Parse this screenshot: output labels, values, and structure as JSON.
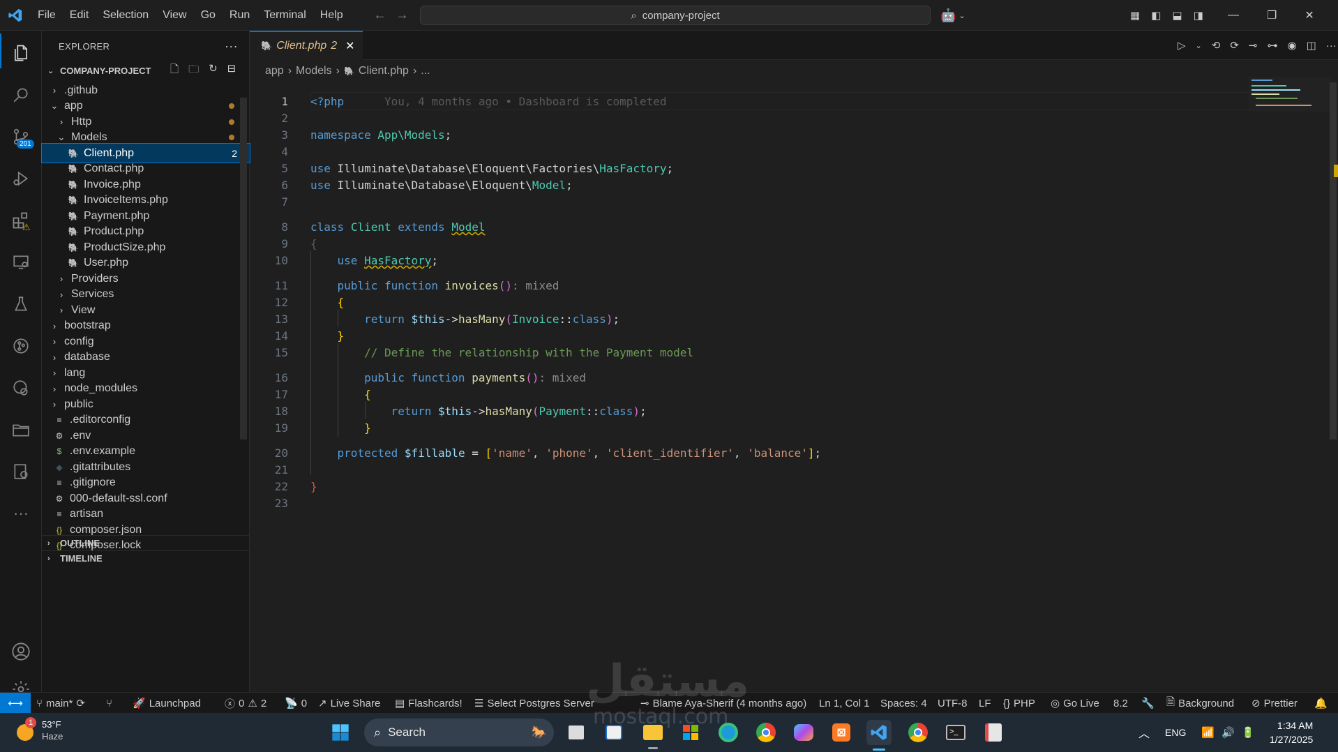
{
  "titlebar": {
    "menu": [
      "File",
      "Edit",
      "Selection",
      "View",
      "Go",
      "Run",
      "Terminal",
      "Help"
    ],
    "search_text": "company-project"
  },
  "explorer": {
    "header": "EXPLORER",
    "project": "COMPANY-PROJECT",
    "items": [
      {
        "label": ".github",
        "type": "folder",
        "open": false,
        "indent": 1
      },
      {
        "label": "app",
        "type": "folder",
        "open": true,
        "indent": 1,
        "modified": true
      },
      {
        "label": "Http",
        "type": "folder",
        "open": false,
        "indent": 2,
        "modified": true
      },
      {
        "label": "Models",
        "type": "folder",
        "open": true,
        "indent": 2,
        "modified": true
      },
      {
        "label": "Client.php",
        "type": "php",
        "indent": 3,
        "badge": "2",
        "selected": true
      },
      {
        "label": "Contact.php",
        "type": "php",
        "indent": 3
      },
      {
        "label": "Invoice.php",
        "type": "php",
        "indent": 3
      },
      {
        "label": "InvoiceItems.php",
        "type": "php",
        "indent": 3
      },
      {
        "label": "Payment.php",
        "type": "php",
        "indent": 3
      },
      {
        "label": "Product.php",
        "type": "php",
        "indent": 3
      },
      {
        "label": "ProductSize.php",
        "type": "php",
        "indent": 3
      },
      {
        "label": "User.php",
        "type": "php",
        "indent": 3
      },
      {
        "label": "Providers",
        "type": "folder",
        "open": false,
        "indent": 2
      },
      {
        "label": "Services",
        "type": "folder",
        "open": false,
        "indent": 2
      },
      {
        "label": "View",
        "type": "folder",
        "open": false,
        "indent": 2
      },
      {
        "label": "bootstrap",
        "type": "folder",
        "open": false,
        "indent": 1
      },
      {
        "label": "config",
        "type": "folder",
        "open": false,
        "indent": 1
      },
      {
        "label": "database",
        "type": "folder",
        "open": false,
        "indent": 1
      },
      {
        "label": "lang",
        "type": "folder",
        "open": false,
        "indent": 1
      },
      {
        "label": "node_modules",
        "type": "folder",
        "open": false,
        "indent": 1
      },
      {
        "label": "public",
        "type": "folder",
        "open": false,
        "indent": 1
      },
      {
        "label": ".editorconfig",
        "type": "lines",
        "indent": 1
      },
      {
        "label": ".env",
        "type": "gear",
        "indent": 1
      },
      {
        "label": ".env.example",
        "type": "dollar",
        "indent": 1
      },
      {
        "label": ".gitattributes",
        "type": "diamond",
        "indent": 1
      },
      {
        "label": ".gitignore",
        "type": "lines",
        "indent": 1
      },
      {
        "label": "000-default-ssl.conf",
        "type": "gear",
        "indent": 1
      },
      {
        "label": "artisan",
        "type": "lines",
        "indent": 1
      },
      {
        "label": "composer.json",
        "type": "braces",
        "indent": 1
      },
      {
        "label": "composer.lock",
        "type": "braces",
        "indent": 1
      }
    ],
    "outline": "OUTLINE",
    "timeline": "TIMELINE",
    "scm_badge": "201"
  },
  "editor": {
    "tab_label": "Client.php",
    "tab_badge": "2",
    "breadcrumb": [
      "app",
      "Models",
      "Client.php",
      "..."
    ],
    "blame_inline": "You, 4 months ago • Dashboard is completed"
  },
  "statusbar": {
    "branch": "main*",
    "launchpad": "Launchpad",
    "errors": "0",
    "warnings": "2",
    "ports": "0",
    "live_share": "Live Share",
    "flashcards": "Flashcards!",
    "postgres": "Select Postgres Server",
    "blame": "Blame Aya-Sherif (4 months ago)",
    "position": "Ln 1, Col 1",
    "spaces": "Spaces: 4",
    "encoding": "UTF-8",
    "eol": "LF",
    "language": "PHP",
    "go_live": "Go Live",
    "php_version": "8.2",
    "background": "Background",
    "prettier": "Prettier"
  },
  "taskbar": {
    "temperature": "53°F",
    "weather": "Haze",
    "weather_badge": "1",
    "search_label": "Search",
    "language": "ENG",
    "time": "1:34 AM",
    "date": "1/27/2025"
  },
  "watermark": {
    "text": "مستقل",
    "sub": "mostaql.com"
  }
}
